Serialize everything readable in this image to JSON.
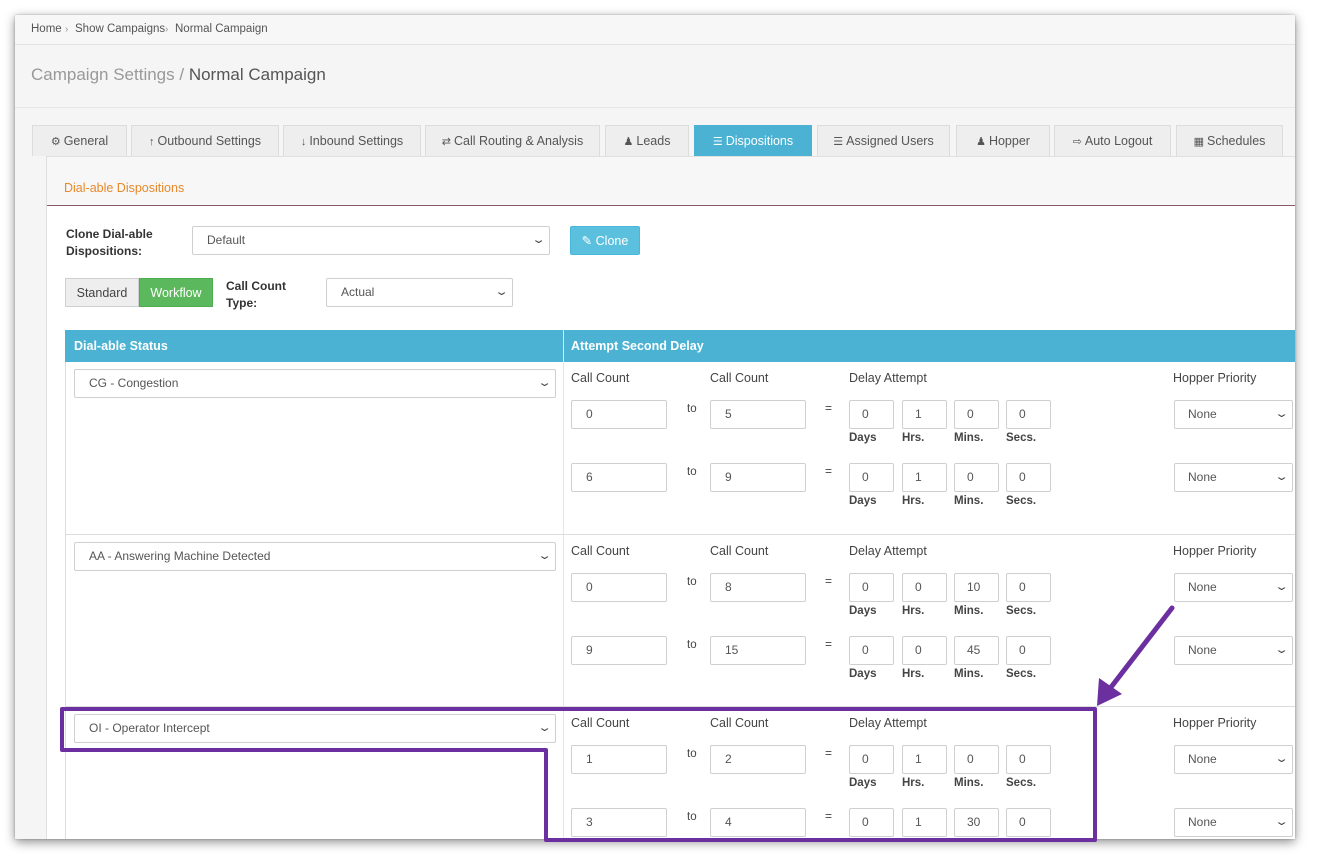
{
  "breadcrumb": {
    "home": "Home",
    "show_campaigns": "Show Campaigns",
    "current": "Normal Campaign",
    "sep_icon": "chevron-right-icon"
  },
  "page_title": {
    "prefix": "Campaign Settings /",
    "campaign": "Normal Campaign"
  },
  "tabs": [
    {
      "label": "General",
      "icon": "gears-icon"
    },
    {
      "label": "Outbound Settings",
      "icon": "arrow-up-icon"
    },
    {
      "label": "Inbound Settings",
      "icon": "arrow-down-icon"
    },
    {
      "label": "Call Routing & Analysis",
      "icon": "random-icon"
    },
    {
      "label": "Leads",
      "icon": "users-icon"
    },
    {
      "label": "Dispositions",
      "icon": "list-icon",
      "active": true
    },
    {
      "label": "Assigned Users",
      "icon": "list-ol-icon"
    },
    {
      "label": "Hopper",
      "icon": "users-icon"
    },
    {
      "label": "Auto Logout",
      "icon": "sign-out-icon"
    },
    {
      "label": "Schedules",
      "icon": "calendar-icon"
    }
  ],
  "section_title": "Dial-able Dispositions",
  "clone": {
    "label": "Clone Dial-able Dispositions:",
    "label_line1": "Clone Dial-able",
    "label_line2": "Dispositions:",
    "selected": "Default",
    "button": "Clone"
  },
  "mode": {
    "standard": "Standard",
    "workflow": "Workflow",
    "active": "Workflow"
  },
  "call_count_type": {
    "label_line1": "Call Count",
    "label_line2": "Type:",
    "selected": "Actual"
  },
  "table": {
    "col_status": "Dial-able Status",
    "col_delay": "Attempt Second Delay",
    "call_count_label": "Call Count",
    "delay_attempt_label": "Delay Attempt",
    "hopper_priority_label": "Hopper Priority",
    "to_label": "to",
    "eq_label": "=",
    "units": {
      "days": "Days",
      "hrs": "Hrs.",
      "mins": "Mins.",
      "secs": "Secs."
    },
    "groups": [
      {
        "status": "CG - Congestion",
        "rows": [
          {
            "from": "0",
            "to": "5",
            "days": "0",
            "hrs": "1",
            "mins": "0",
            "secs": "0",
            "priority": "None"
          },
          {
            "from": "6",
            "to": "9",
            "days": "0",
            "hrs": "1",
            "mins": "0",
            "secs": "0",
            "priority": "None"
          }
        ]
      },
      {
        "status": "AA - Answering Machine Detected",
        "rows": [
          {
            "from": "0",
            "to": "8",
            "days": "0",
            "hrs": "0",
            "mins": "10",
            "secs": "0",
            "priority": "None"
          },
          {
            "from": "9",
            "to": "15",
            "days": "0",
            "hrs": "0",
            "mins": "45",
            "secs": "0",
            "priority": "None"
          }
        ]
      },
      {
        "status": "OI - Operator Intercept",
        "rows": [
          {
            "from": "1",
            "to": "2",
            "days": "0",
            "hrs": "1",
            "mins": "0",
            "secs": "0",
            "priority": "None"
          },
          {
            "from": "3",
            "to": "4",
            "days": "0",
            "hrs": "1",
            "mins": "30",
            "secs": "0",
            "priority": "None"
          }
        ]
      }
    ]
  },
  "colors": {
    "tab_active": "#4cb2d3",
    "workflow": "#5cb85c",
    "clone_button": "#5bc0de",
    "section_title": "#e8892a",
    "annotation": "#6b2fa0"
  }
}
